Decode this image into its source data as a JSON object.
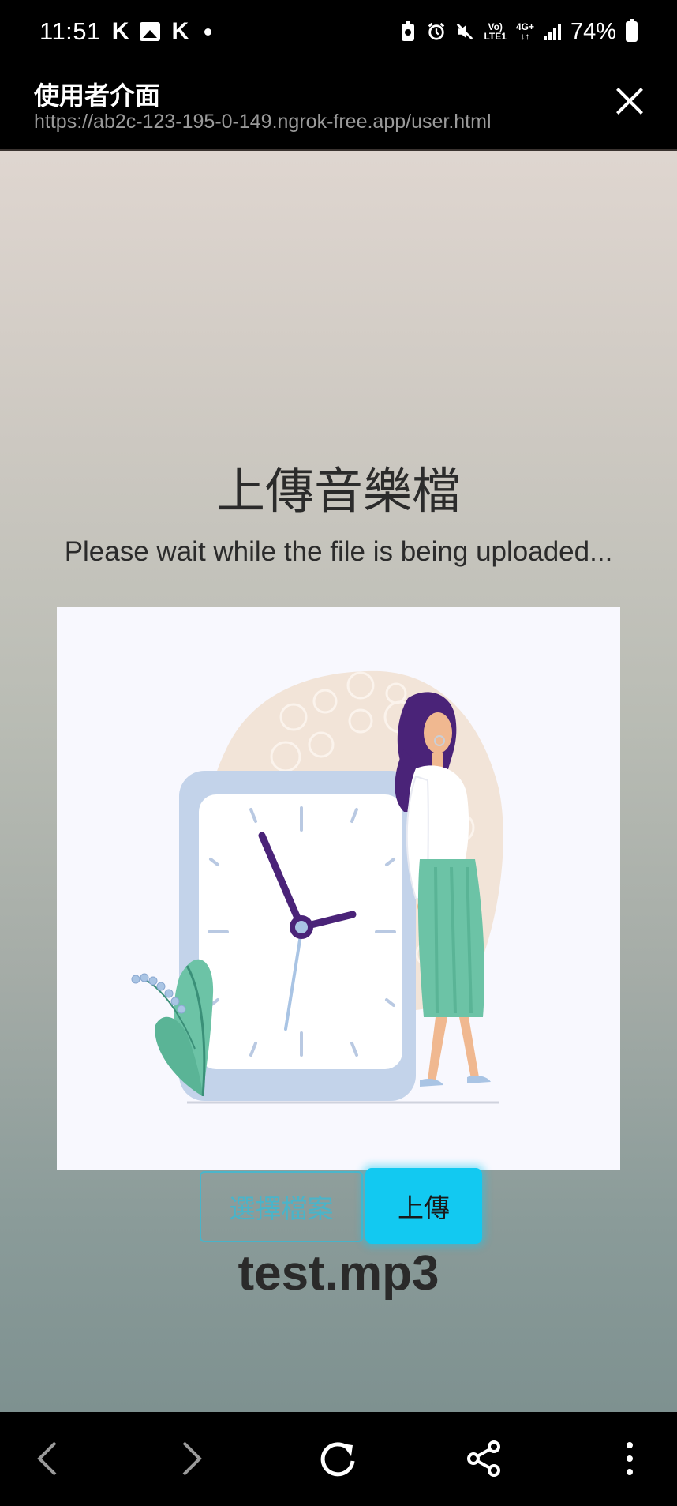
{
  "status_bar": {
    "time": "11:51",
    "left_icons": [
      "K",
      "image-icon",
      "K",
      "dot"
    ],
    "right_icons": [
      "battery-saver-icon",
      "alarm-icon",
      "mute-icon",
      "volte-icon",
      "4g-icon",
      "signal-icon"
    ],
    "volte_label_top": "Vo)",
    "volte_label_bottom": "LTE1",
    "net_label_top": "4G+",
    "net_label_bottom": "↓↑",
    "battery_percent": "74%"
  },
  "browser": {
    "title": "使用者介面",
    "url": "https://ab2c-123-195-0-149.ngrok-free.app/user.html"
  },
  "main": {
    "heading": "上傳音樂檔",
    "subheading": "Please wait while the file is being uploaded...",
    "choose_button_label": "選擇檔案",
    "upload_button_label": "上傳",
    "file_name": "test.mp3"
  },
  "colors": {
    "accent": "#12c9f1",
    "clock_hand": "#4a2378",
    "clock_frame": "#c3d3ea",
    "skirt": "#6cc3a6",
    "blob": "#f2e4d8"
  }
}
